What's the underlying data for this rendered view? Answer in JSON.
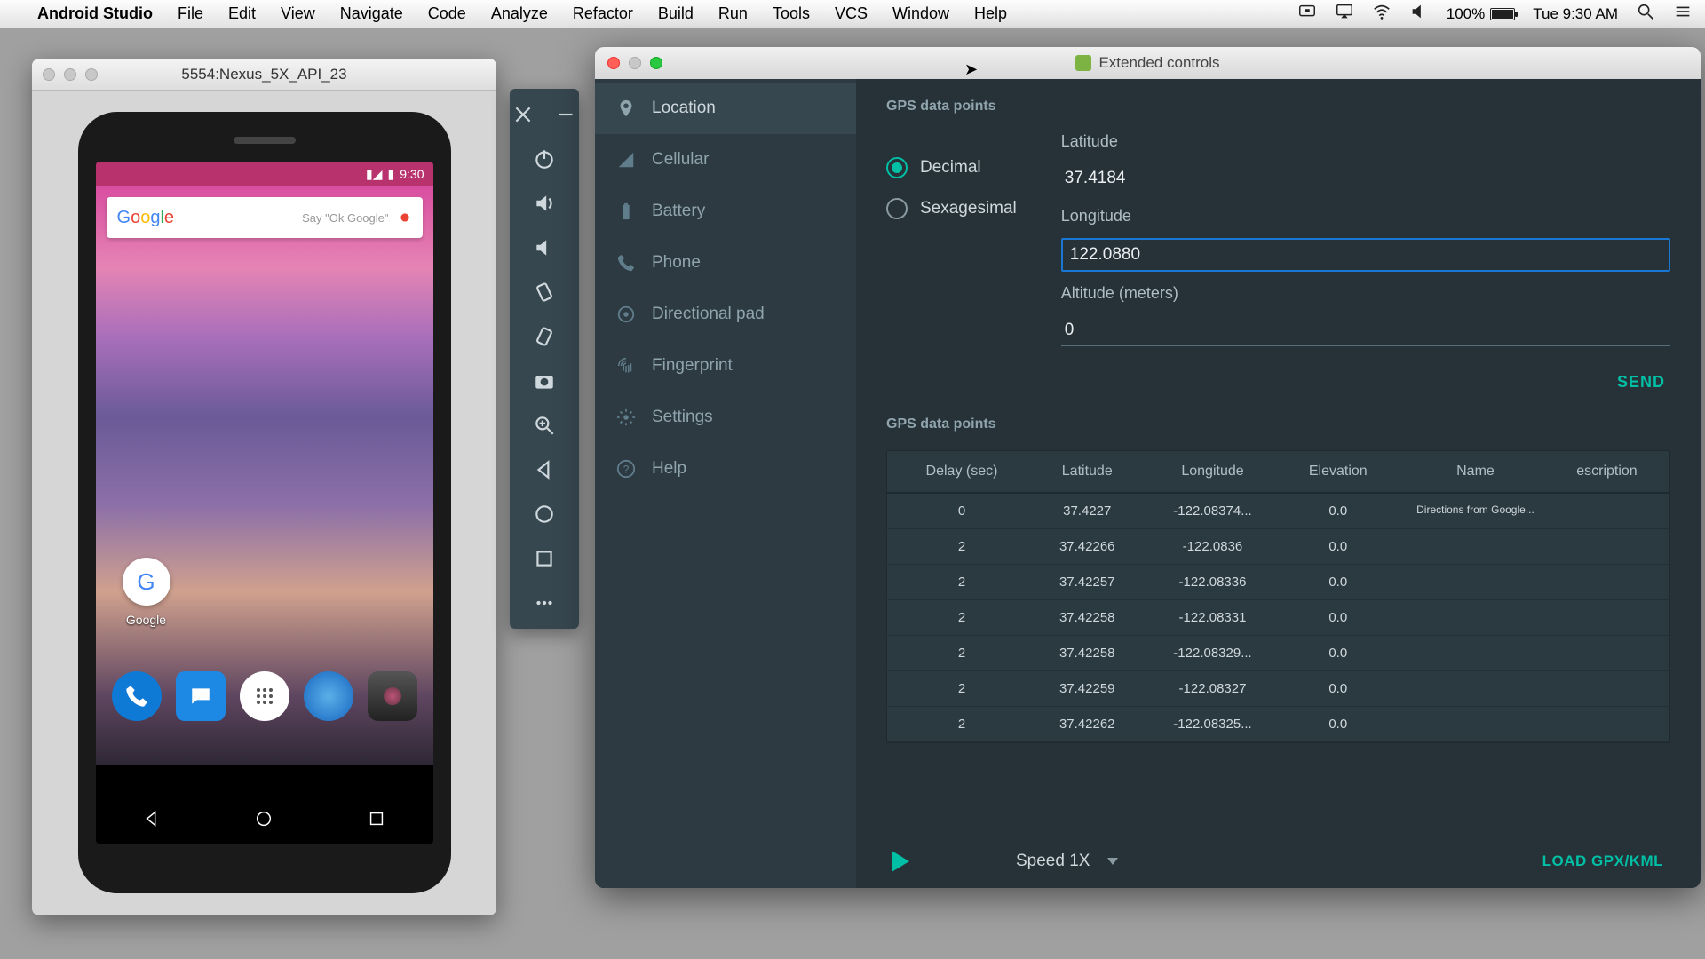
{
  "menubar": {
    "app": "Android Studio",
    "items": [
      "File",
      "Edit",
      "View",
      "Navigate",
      "Code",
      "Analyze",
      "Refactor",
      "Build",
      "Run",
      "Tools",
      "VCS",
      "Window",
      "Help"
    ],
    "battery": "100%",
    "clock": "Tue 9:30 AM"
  },
  "emulator": {
    "title": "5554:Nexus_5X_API_23",
    "status_time": "9:30",
    "search_hint": "Say \"Ok Google\"",
    "google_label": "Google"
  },
  "extended": {
    "title": "Extended controls",
    "categories": [
      {
        "label": "Location",
        "icon": "location"
      },
      {
        "label": "Cellular",
        "icon": "cellular"
      },
      {
        "label": "Battery",
        "icon": "battery"
      },
      {
        "label": "Phone",
        "icon": "phone"
      },
      {
        "label": "Directional pad",
        "icon": "dpad"
      },
      {
        "label": "Fingerprint",
        "icon": "fingerprint"
      },
      {
        "label": "Settings",
        "icon": "settings"
      },
      {
        "label": "Help",
        "icon": "help"
      }
    ],
    "active_category": 0,
    "gps": {
      "section1": "GPS data points",
      "format_options": [
        "Decimal",
        "Sexagesimal"
      ],
      "format_selected": 0,
      "lat_label": "Latitude",
      "lat_value": "37.4184",
      "lon_label": "Longitude",
      "lon_value": "122.0880",
      "alt_label": "Altitude (meters)",
      "alt_value": "0",
      "send": "SEND",
      "section2": "GPS data points",
      "columns": [
        "Delay (sec)",
        "Latitude",
        "Longitude",
        "Elevation",
        "Name",
        "escription"
      ],
      "rows": [
        {
          "delay": "0",
          "lat": "37.4227",
          "lon": "-122.08374...",
          "elev": "0.0",
          "name": "Directions from Google...",
          "desc": ""
        },
        {
          "delay": "2",
          "lat": "37.42266",
          "lon": "-122.0836",
          "elev": "0.0",
          "name": "",
          "desc": ""
        },
        {
          "delay": "2",
          "lat": "37.42257",
          "lon": "-122.08336",
          "elev": "0.0",
          "name": "",
          "desc": ""
        },
        {
          "delay": "2",
          "lat": "37.42258",
          "lon": "-122.08331",
          "elev": "0.0",
          "name": "",
          "desc": ""
        },
        {
          "delay": "2",
          "lat": "37.42258",
          "lon": "-122.08329...",
          "elev": "0.0",
          "name": "",
          "desc": ""
        },
        {
          "delay": "2",
          "lat": "37.42259",
          "lon": "-122.08327",
          "elev": "0.0",
          "name": "",
          "desc": ""
        },
        {
          "delay": "2",
          "lat": "37.42262",
          "lon": "-122.08325...",
          "elev": "0.0",
          "name": "",
          "desc": ""
        }
      ],
      "speed_label": "Speed 1X",
      "load": "LOAD GPX/KML"
    }
  }
}
